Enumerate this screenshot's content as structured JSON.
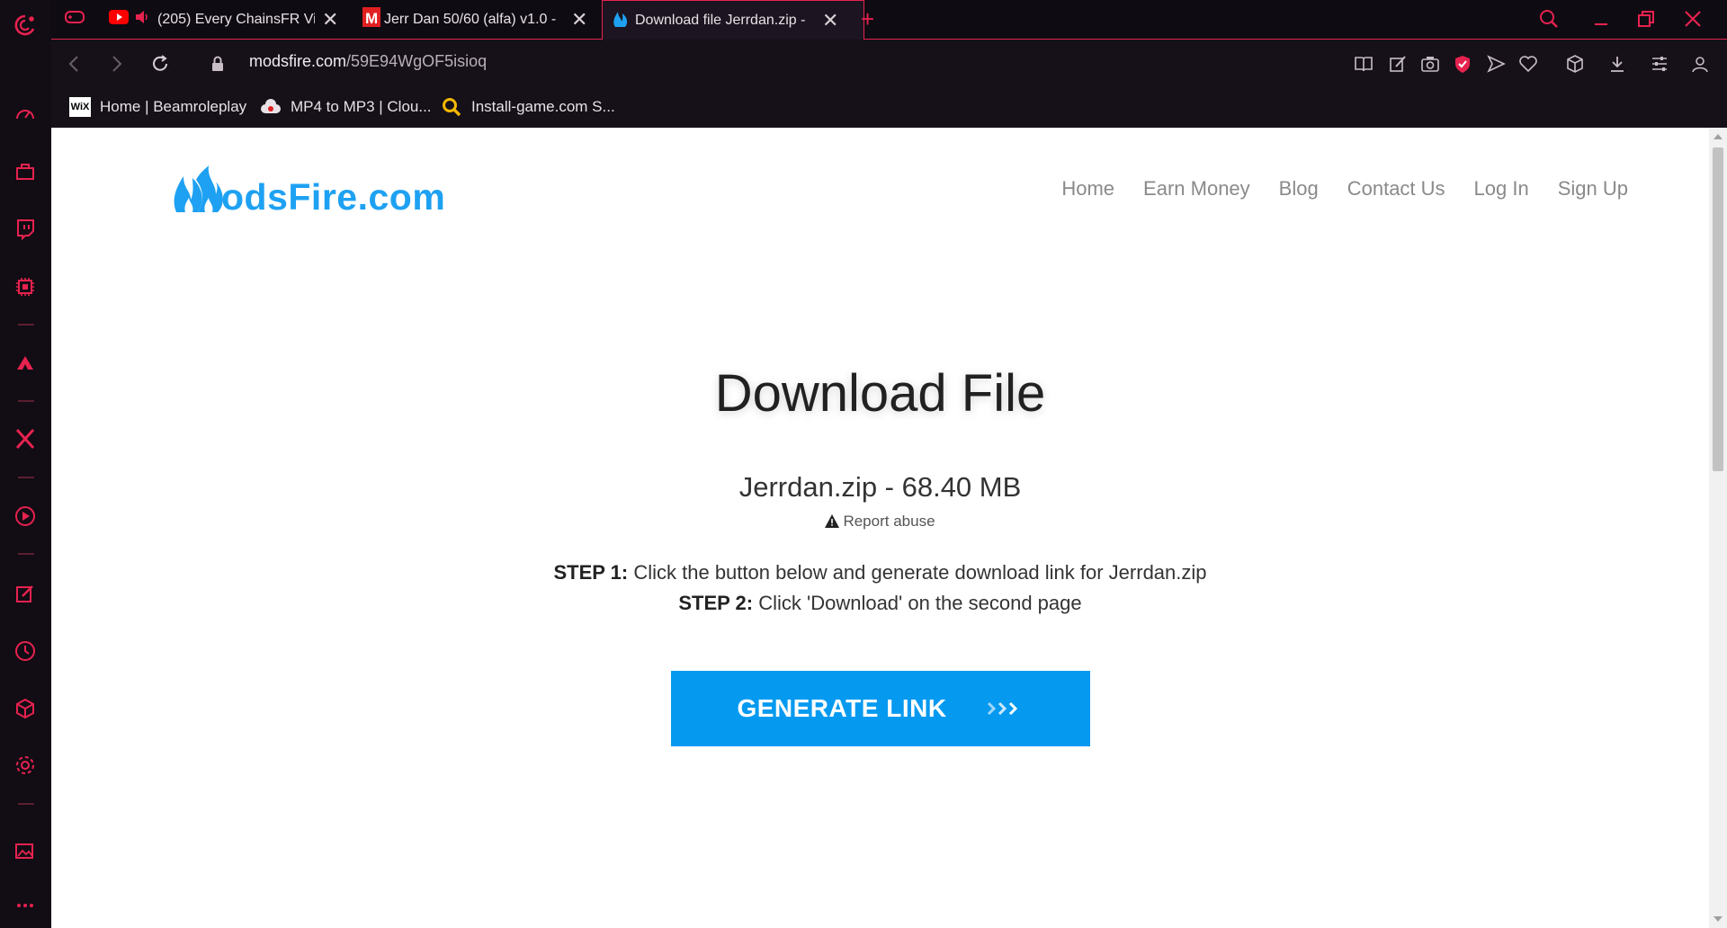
{
  "colors": {
    "accent": "#e6224f",
    "brand_blue": "#1ea1f2",
    "button_blue": "#059af0"
  },
  "tabs": [
    {
      "icon": "youtube-icon",
      "extra_icon": "speaker-icon",
      "title": "(205) Every ChainsFR Vi"
    },
    {
      "icon": "m-site-icon",
      "title": "Jerr Dan 50/60 (alfa) v1.0 -"
    },
    {
      "icon": "modsfire-icon",
      "title": "Download file Jerrdan.zip -",
      "active": true
    }
  ],
  "address": {
    "domain": "modsfire.com",
    "path": "/59E94WgOF5isioq"
  },
  "bookmarks": [
    {
      "icon": "wix-icon",
      "label": "Home | Beamroleplay",
      "icon_text": "WiX"
    },
    {
      "icon": "cloud-converter-icon",
      "label": "MP4 to MP3 | Clou..."
    },
    {
      "icon": "search-magnifier-icon",
      "label": "Install-game.com S..."
    }
  ],
  "site": {
    "logo_text": "odsFire.com",
    "nav": [
      "Home",
      "Earn Money",
      "Blog",
      "Contact Us",
      "Log In",
      "Sign Up"
    ]
  },
  "page": {
    "title": "Download File",
    "file_info": "Jerrdan.zip - 68.40 MB",
    "report": "Report abuse",
    "step1_label": "STEP 1:",
    "step1_text": " Click the button below and generate download link for Jerrdan.zip",
    "step2_label": "STEP 2:",
    "step2_text": " Click 'Download' on the second page",
    "button": "GENERATE LINK"
  }
}
